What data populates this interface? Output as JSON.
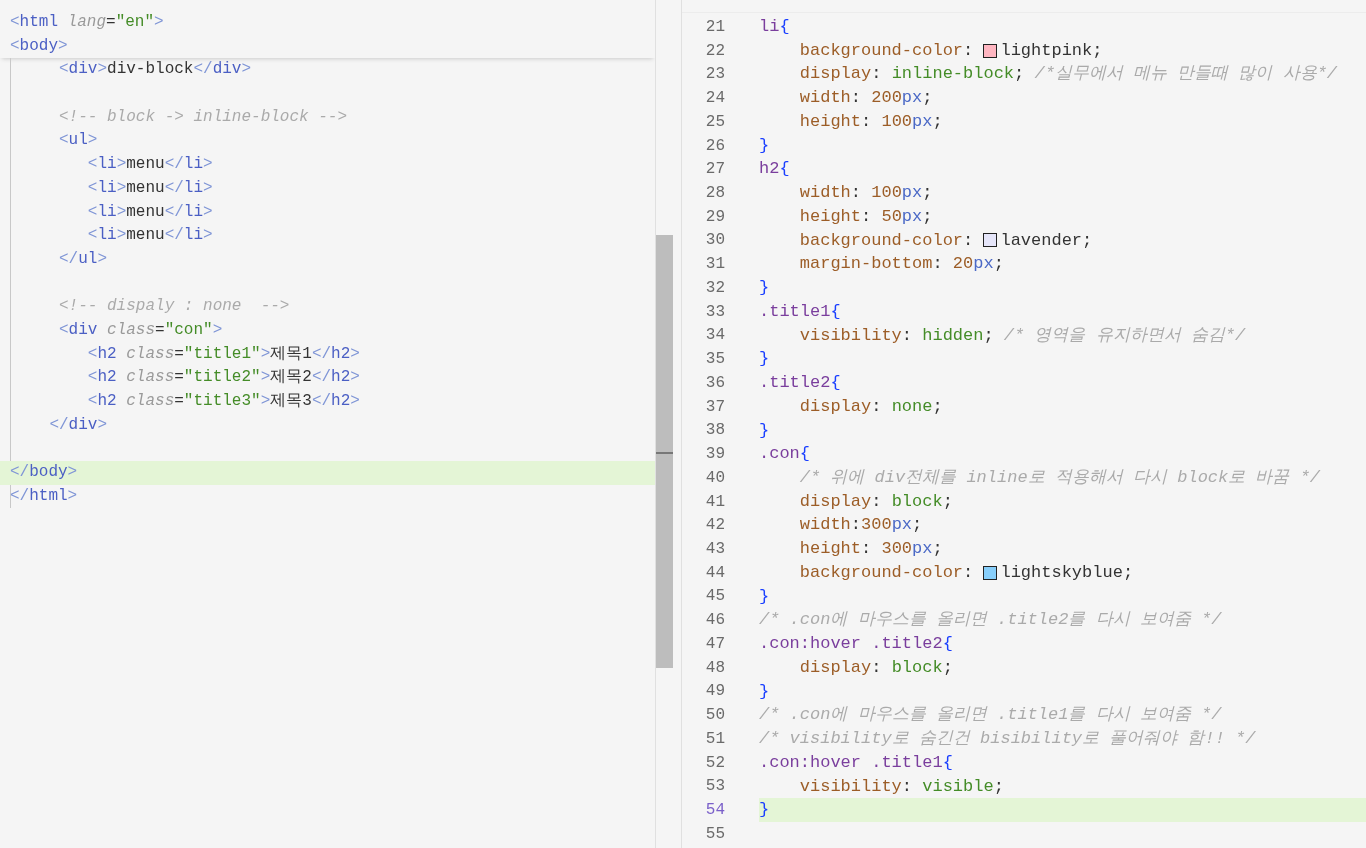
{
  "left_editor": {
    "sticky_lines": [
      {
        "tokens": [
          {
            "kind": "bracket",
            "text": "<"
          },
          {
            "kind": "tag",
            "text": "html"
          },
          {
            "kind": "attr",
            "text": " lang"
          },
          {
            "kind": "punc",
            "text": "="
          },
          {
            "kind": "string",
            "text": "\"en\""
          },
          {
            "kind": "bracket",
            "text": ">"
          }
        ]
      },
      {
        "tokens": [
          {
            "kind": "bracket",
            "text": "<"
          },
          {
            "kind": "tag",
            "text": "body"
          },
          {
            "kind": "bracket",
            "text": ">"
          }
        ]
      }
    ],
    "lines": [
      {
        "current": false,
        "tokens": [
          {
            "kind": "bracket",
            "text": "     <"
          },
          {
            "kind": "tag",
            "text": "div"
          },
          {
            "kind": "bracket",
            "text": ">"
          },
          {
            "kind": "text",
            "text": "div-block"
          },
          {
            "kind": "bracket",
            "text": "</"
          },
          {
            "kind": "tag",
            "text": "div"
          },
          {
            "kind": "bracket",
            "text": ">"
          }
        ]
      },
      {
        "current": false
      },
      {
        "current": false,
        "tokens": [
          {
            "kind": "comment",
            "text": "     <!-- block -> inline-block -->"
          }
        ]
      },
      {
        "current": false,
        "tokens": [
          {
            "kind": "bracket",
            "text": "     <"
          },
          {
            "kind": "tag",
            "text": "ul"
          },
          {
            "kind": "bracket",
            "text": ">"
          }
        ]
      },
      {
        "current": false,
        "tokens": [
          {
            "kind": "bracket",
            "text": "        <"
          },
          {
            "kind": "tag",
            "text": "li"
          },
          {
            "kind": "bracket",
            "text": ">"
          },
          {
            "kind": "text",
            "text": "menu"
          },
          {
            "kind": "bracket",
            "text": "</"
          },
          {
            "kind": "tag",
            "text": "li"
          },
          {
            "kind": "bracket",
            "text": ">"
          }
        ]
      },
      {
        "current": false,
        "tokens": [
          {
            "kind": "bracket",
            "text": "        <"
          },
          {
            "kind": "tag",
            "text": "li"
          },
          {
            "kind": "bracket",
            "text": ">"
          },
          {
            "kind": "text",
            "text": "menu"
          },
          {
            "kind": "bracket",
            "text": "</"
          },
          {
            "kind": "tag",
            "text": "li"
          },
          {
            "kind": "bracket",
            "text": ">"
          }
        ]
      },
      {
        "current": false,
        "tokens": [
          {
            "kind": "bracket",
            "text": "        <"
          },
          {
            "kind": "tag",
            "text": "li"
          },
          {
            "kind": "bracket",
            "text": ">"
          },
          {
            "kind": "text",
            "text": "menu"
          },
          {
            "kind": "bracket",
            "text": "</"
          },
          {
            "kind": "tag",
            "text": "li"
          },
          {
            "kind": "bracket",
            "text": ">"
          }
        ]
      },
      {
        "current": false,
        "tokens": [
          {
            "kind": "bracket",
            "text": "        <"
          },
          {
            "kind": "tag",
            "text": "li"
          },
          {
            "kind": "bracket",
            "text": ">"
          },
          {
            "kind": "text",
            "text": "menu"
          },
          {
            "kind": "bracket",
            "text": "</"
          },
          {
            "kind": "tag",
            "text": "li"
          },
          {
            "kind": "bracket",
            "text": ">"
          }
        ]
      },
      {
        "current": false,
        "tokens": [
          {
            "kind": "bracket",
            "text": "     </"
          },
          {
            "kind": "tag",
            "text": "ul"
          },
          {
            "kind": "bracket",
            "text": ">"
          }
        ]
      },
      {
        "current": false
      },
      {
        "current": false,
        "tokens": [
          {
            "kind": "comment",
            "text": "     <!-- dispaly : none  -->"
          }
        ]
      },
      {
        "current": false,
        "tokens": [
          {
            "kind": "bracket",
            "text": "     <"
          },
          {
            "kind": "tag",
            "text": "div"
          },
          {
            "kind": "attr",
            "text": " class"
          },
          {
            "kind": "punc",
            "text": "="
          },
          {
            "kind": "string",
            "text": "\"con\""
          },
          {
            "kind": "bracket",
            "text": ">"
          }
        ]
      },
      {
        "current": false,
        "tokens": [
          {
            "kind": "bracket",
            "text": "        <"
          },
          {
            "kind": "tag",
            "text": "h2"
          },
          {
            "kind": "attr",
            "text": " class"
          },
          {
            "kind": "punc",
            "text": "="
          },
          {
            "kind": "string",
            "text": "\"title1\""
          },
          {
            "kind": "bracket",
            "text": ">"
          },
          {
            "kind": "text",
            "text": "제목1"
          },
          {
            "kind": "bracket",
            "text": "</"
          },
          {
            "kind": "tag",
            "text": "h2"
          },
          {
            "kind": "bracket",
            "text": ">"
          }
        ]
      },
      {
        "current": false,
        "tokens": [
          {
            "kind": "bracket",
            "text": "        <"
          },
          {
            "kind": "tag",
            "text": "h2"
          },
          {
            "kind": "attr",
            "text": " class"
          },
          {
            "kind": "punc",
            "text": "="
          },
          {
            "kind": "string",
            "text": "\"title2\""
          },
          {
            "kind": "bracket",
            "text": ">"
          },
          {
            "kind": "text",
            "text": "제목2"
          },
          {
            "kind": "bracket",
            "text": "</"
          },
          {
            "kind": "tag",
            "text": "h2"
          },
          {
            "kind": "bracket",
            "text": ">"
          }
        ]
      },
      {
        "current": false,
        "tokens": [
          {
            "kind": "bracket",
            "text": "        <"
          },
          {
            "kind": "tag",
            "text": "h2"
          },
          {
            "kind": "attr",
            "text": " class"
          },
          {
            "kind": "punc",
            "text": "="
          },
          {
            "kind": "string",
            "text": "\"title3\""
          },
          {
            "kind": "bracket",
            "text": ">"
          },
          {
            "kind": "text",
            "text": "제목3"
          },
          {
            "kind": "bracket",
            "text": "</"
          },
          {
            "kind": "tag",
            "text": "h2"
          },
          {
            "kind": "bracket",
            "text": ">"
          }
        ]
      },
      {
        "current": false,
        "tokens": [
          {
            "kind": "bracket",
            "text": "    </"
          },
          {
            "kind": "tag",
            "text": "div"
          },
          {
            "kind": "bracket",
            "text": ">"
          }
        ]
      },
      {
        "current": false
      },
      {
        "current": true,
        "tokens": [
          {
            "kind": "bracket",
            "text": "</"
          },
          {
            "kind": "tag",
            "text": "body"
          },
          {
            "kind": "bracket",
            "text": ">"
          }
        ]
      },
      {
        "current": false,
        "tokens": [
          {
            "kind": "bracket",
            "text": "</"
          },
          {
            "kind": "tag",
            "text": "html"
          },
          {
            "kind": "bracket",
            "text": ">"
          }
        ]
      }
    ]
  },
  "right_editor": {
    "lines": [
      {
        "number": "21",
        "current": false,
        "tokens": [
          {
            "kind": "selector",
            "text": "li"
          },
          {
            "kind": "brace",
            "text": "{"
          }
        ]
      },
      {
        "number": "22",
        "current": false,
        "tokens": [
          {
            "kind": "property",
            "text": "    background-color"
          },
          {
            "kind": "punc",
            "text": ": "
          },
          {
            "kind": "swatch",
            "color": "#ffb6c1"
          },
          {
            "kind": "text",
            "text": "lightpink"
          },
          {
            "kind": "punc",
            "text": ";"
          }
        ]
      },
      {
        "number": "23",
        "current": false,
        "tokens": [
          {
            "kind": "property",
            "text": "    display"
          },
          {
            "kind": "punc",
            "text": ": "
          },
          {
            "kind": "keyword",
            "text": "inline-block"
          },
          {
            "kind": "punc",
            "text": "; "
          },
          {
            "kind": "comment",
            "text": "/*실무에서 메뉴 만들때 많이 사용*/"
          }
        ]
      },
      {
        "number": "24",
        "current": false,
        "tokens": [
          {
            "kind": "property",
            "text": "    width"
          },
          {
            "kind": "punc",
            "text": ": "
          },
          {
            "kind": "number",
            "text": "200"
          },
          {
            "kind": "unit",
            "text": "px"
          },
          {
            "kind": "punc",
            "text": ";"
          }
        ]
      },
      {
        "number": "25",
        "current": false,
        "tokens": [
          {
            "kind": "property",
            "text": "    height"
          },
          {
            "kind": "punc",
            "text": ": "
          },
          {
            "kind": "number",
            "text": "100"
          },
          {
            "kind": "unit",
            "text": "px"
          },
          {
            "kind": "punc",
            "text": ";"
          }
        ]
      },
      {
        "number": "26",
        "current": false,
        "tokens": [
          {
            "kind": "brace",
            "text": "}"
          }
        ]
      },
      {
        "number": "27",
        "current": false,
        "tokens": [
          {
            "kind": "selector",
            "text": "h2"
          },
          {
            "kind": "brace",
            "text": "{"
          }
        ]
      },
      {
        "number": "28",
        "current": false,
        "tokens": [
          {
            "kind": "property",
            "text": "    width"
          },
          {
            "kind": "punc",
            "text": ": "
          },
          {
            "kind": "number",
            "text": "100"
          },
          {
            "kind": "unit",
            "text": "px"
          },
          {
            "kind": "punc",
            "text": ";"
          }
        ]
      },
      {
        "number": "29",
        "current": false,
        "tokens": [
          {
            "kind": "property",
            "text": "    height"
          },
          {
            "kind": "punc",
            "text": ": "
          },
          {
            "kind": "number",
            "text": "50"
          },
          {
            "kind": "unit",
            "text": "px"
          },
          {
            "kind": "punc",
            "text": ";"
          }
        ]
      },
      {
        "number": "30",
        "current": false,
        "tokens": [
          {
            "kind": "property",
            "text": "    background-color"
          },
          {
            "kind": "punc",
            "text": ": "
          },
          {
            "kind": "swatch",
            "color": "#e6e6fa"
          },
          {
            "kind": "text",
            "text": "lavender"
          },
          {
            "kind": "punc",
            "text": ";"
          }
        ]
      },
      {
        "number": "31",
        "current": false,
        "tokens": [
          {
            "kind": "property",
            "text": "    margin-bottom"
          },
          {
            "kind": "punc",
            "text": ": "
          },
          {
            "kind": "number",
            "text": "20"
          },
          {
            "kind": "unit",
            "text": "px"
          },
          {
            "kind": "punc",
            "text": ";"
          }
        ]
      },
      {
        "number": "32",
        "current": false,
        "tokens": [
          {
            "kind": "brace",
            "text": "}"
          }
        ]
      },
      {
        "number": "33",
        "current": false,
        "tokens": [
          {
            "kind": "selector",
            "text": ".title1"
          },
          {
            "kind": "brace",
            "text": "{"
          }
        ]
      },
      {
        "number": "34",
        "current": false,
        "tokens": [
          {
            "kind": "property",
            "text": "    visibility"
          },
          {
            "kind": "punc",
            "text": ": "
          },
          {
            "kind": "keyword",
            "text": "hidden"
          },
          {
            "kind": "punc",
            "text": "; "
          },
          {
            "kind": "comment",
            "text": "/* 영역을 유지하면서 숨김*/"
          }
        ]
      },
      {
        "number": "35",
        "current": false,
        "tokens": [
          {
            "kind": "brace",
            "text": "}"
          }
        ]
      },
      {
        "number": "36",
        "current": false,
        "tokens": [
          {
            "kind": "selector",
            "text": ".title2"
          },
          {
            "kind": "brace",
            "text": "{"
          }
        ]
      },
      {
        "number": "37",
        "current": false,
        "tokens": [
          {
            "kind": "property",
            "text": "    display"
          },
          {
            "kind": "punc",
            "text": ": "
          },
          {
            "kind": "keyword",
            "text": "none"
          },
          {
            "kind": "punc",
            "text": ";"
          }
        ]
      },
      {
        "number": "38",
        "current": false,
        "tokens": [
          {
            "kind": "brace",
            "text": "}"
          }
        ]
      },
      {
        "number": "39",
        "current": false,
        "tokens": [
          {
            "kind": "selector",
            "text": ".con"
          },
          {
            "kind": "brace",
            "text": "{"
          }
        ]
      },
      {
        "number": "40",
        "current": false,
        "tokens": [
          {
            "kind": "comment",
            "text": "    /* 위에 div전체를 inline로 적용해서 다시 block로 바꿈 */"
          }
        ]
      },
      {
        "number": "41",
        "current": false,
        "tokens": [
          {
            "kind": "property",
            "text": "    display"
          },
          {
            "kind": "punc",
            "text": ": "
          },
          {
            "kind": "keyword",
            "text": "block"
          },
          {
            "kind": "punc",
            "text": ";"
          }
        ]
      },
      {
        "number": "42",
        "current": false,
        "tokens": [
          {
            "kind": "property",
            "text": "    width"
          },
          {
            "kind": "punc",
            "text": ":"
          },
          {
            "kind": "number",
            "text": "300"
          },
          {
            "kind": "unit",
            "text": "px"
          },
          {
            "kind": "punc",
            "text": ";"
          }
        ]
      },
      {
        "number": "43",
        "current": false,
        "tokens": [
          {
            "kind": "property",
            "text": "    height"
          },
          {
            "kind": "punc",
            "text": ": "
          },
          {
            "kind": "number",
            "text": "300"
          },
          {
            "kind": "unit",
            "text": "px"
          },
          {
            "kind": "punc",
            "text": ";"
          }
        ]
      },
      {
        "number": "44",
        "current": false,
        "tokens": [
          {
            "kind": "property",
            "text": "    background-color"
          },
          {
            "kind": "punc",
            "text": ": "
          },
          {
            "kind": "swatch",
            "color": "#87cefa"
          },
          {
            "kind": "text",
            "text": "lightskyblue"
          },
          {
            "kind": "punc",
            "text": ";"
          }
        ]
      },
      {
        "number": "45",
        "current": false,
        "tokens": [
          {
            "kind": "brace",
            "text": "}"
          }
        ]
      },
      {
        "number": "46",
        "current": false,
        "tokens": [
          {
            "kind": "comment",
            "text": "/* .con에 마우스를 올리면 .title2를 다시 보여줌 */"
          }
        ]
      },
      {
        "number": "47",
        "current": false,
        "tokens": [
          {
            "kind": "selector",
            "text": ".con:hover .title2"
          },
          {
            "kind": "brace",
            "text": "{"
          }
        ]
      },
      {
        "number": "48",
        "current": false,
        "tokens": [
          {
            "kind": "property",
            "text": "    display"
          },
          {
            "kind": "punc",
            "text": ": "
          },
          {
            "kind": "keyword",
            "text": "block"
          },
          {
            "kind": "punc",
            "text": ";"
          }
        ]
      },
      {
        "number": "49",
        "current": false,
        "tokens": [
          {
            "kind": "brace",
            "text": "}"
          }
        ]
      },
      {
        "number": "50",
        "current": false,
        "tokens": [
          {
            "kind": "comment",
            "text": "/* .con에 마우스를 올리면 .title1를 다시 보여줌 */"
          }
        ]
      },
      {
        "number": "51",
        "current": false,
        "tokens": [
          {
            "kind": "comment",
            "text": "/* visibility로 숨긴건 bisibility로 풀어줘야 함!! */"
          }
        ]
      },
      {
        "number": "52",
        "current": false,
        "tokens": [
          {
            "kind": "selector",
            "text": ".con:hover .title1"
          },
          {
            "kind": "brace",
            "text": "{"
          }
        ]
      },
      {
        "number": "53",
        "current": false,
        "tokens": [
          {
            "kind": "property",
            "text": "    visibility"
          },
          {
            "kind": "punc",
            "text": ": "
          },
          {
            "kind": "keyword",
            "text": "visible"
          },
          {
            "kind": "punc",
            "text": ";"
          }
        ]
      },
      {
        "number": "54",
        "current": true,
        "tokens": [
          {
            "kind": "brace",
            "text": "}"
          }
        ]
      },
      {
        "number": "55",
        "current": false
      }
    ]
  }
}
